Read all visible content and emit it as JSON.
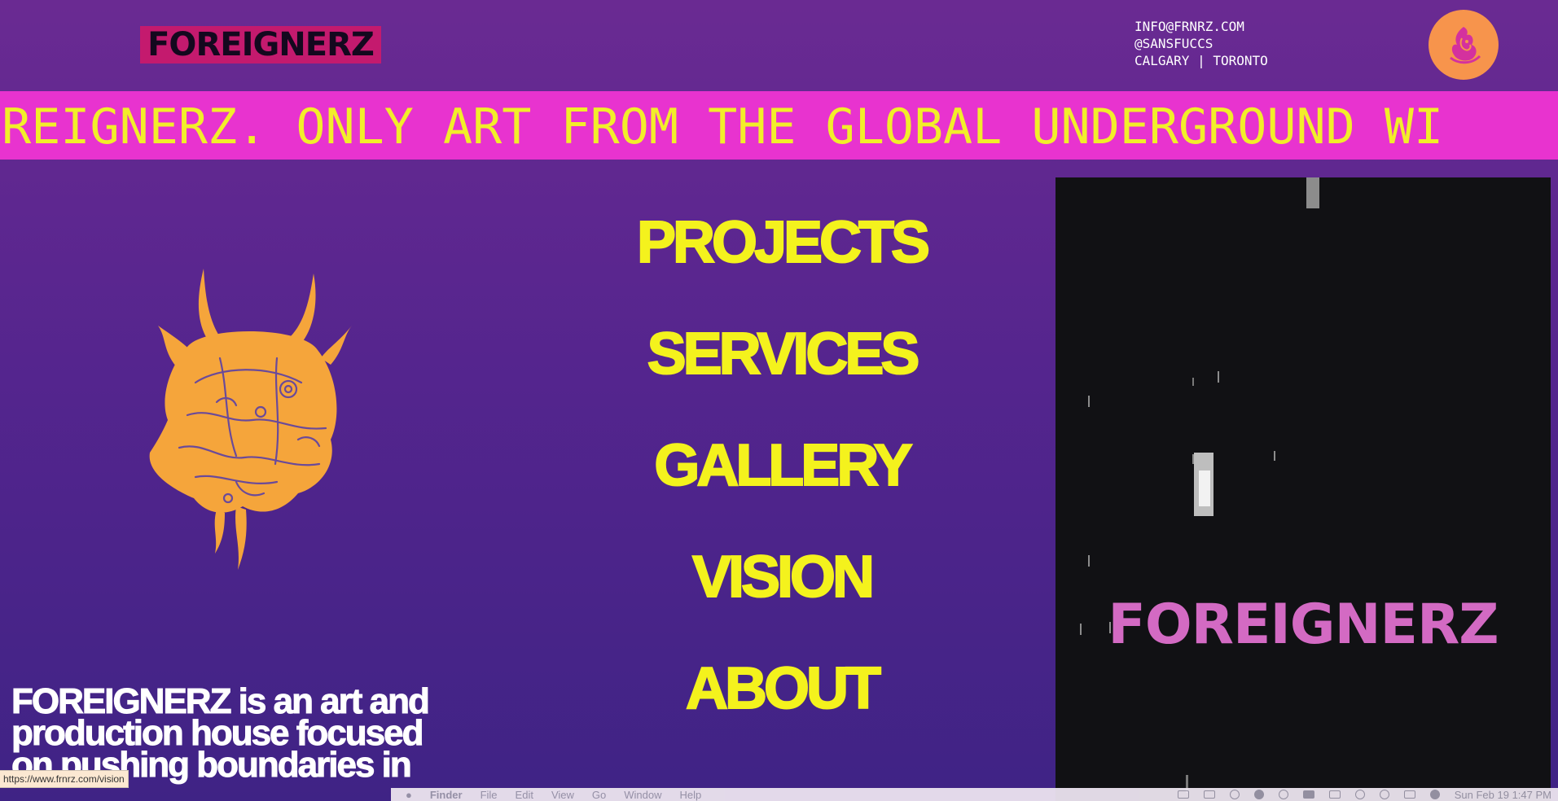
{
  "header": {
    "logo_text": "FOREIGNERZ",
    "contact": {
      "email": "INFO@FRNRZ.COM",
      "handle": "@SANSFUCCS",
      "cities": "CALGARY | TORONTO"
    },
    "avatar_icon": "flame-creature-icon"
  },
  "marquee": {
    "text": "OREIGNERZ. ONLY ART FROM THE GLOBAL UNDERGROUND WI"
  },
  "nav": {
    "items": [
      {
        "label": "PROJECTS"
      },
      {
        "label": "SERVICES"
      },
      {
        "label": "GALLERY"
      },
      {
        "label": "VISION"
      },
      {
        "label": "ABOUT"
      }
    ]
  },
  "intro": {
    "text": "FOREIGNERZ is an art and production house focused on pushing boundaries in"
  },
  "video": {
    "overlay_text": "FOREIGNERZ"
  },
  "status_bar": {
    "url": "https://www.frnrz.com/vision"
  },
  "menubar": {
    "app": "Finder",
    "items": [
      "File",
      "Edit",
      "View",
      "Go",
      "Window",
      "Help"
    ],
    "clock": "Sun Feb 19  1:47 PM"
  },
  "colors": {
    "background_top": "#6a2a92",
    "background_bottom": "#3f2385",
    "marquee_bg": "#e833cf",
    "accent_yellow": "#f4f21d",
    "logo_bg": "#c41a6e",
    "avatar_bg": "#f7944c",
    "creature": "#f5a53b",
    "video_logo": "#d36ac3"
  }
}
